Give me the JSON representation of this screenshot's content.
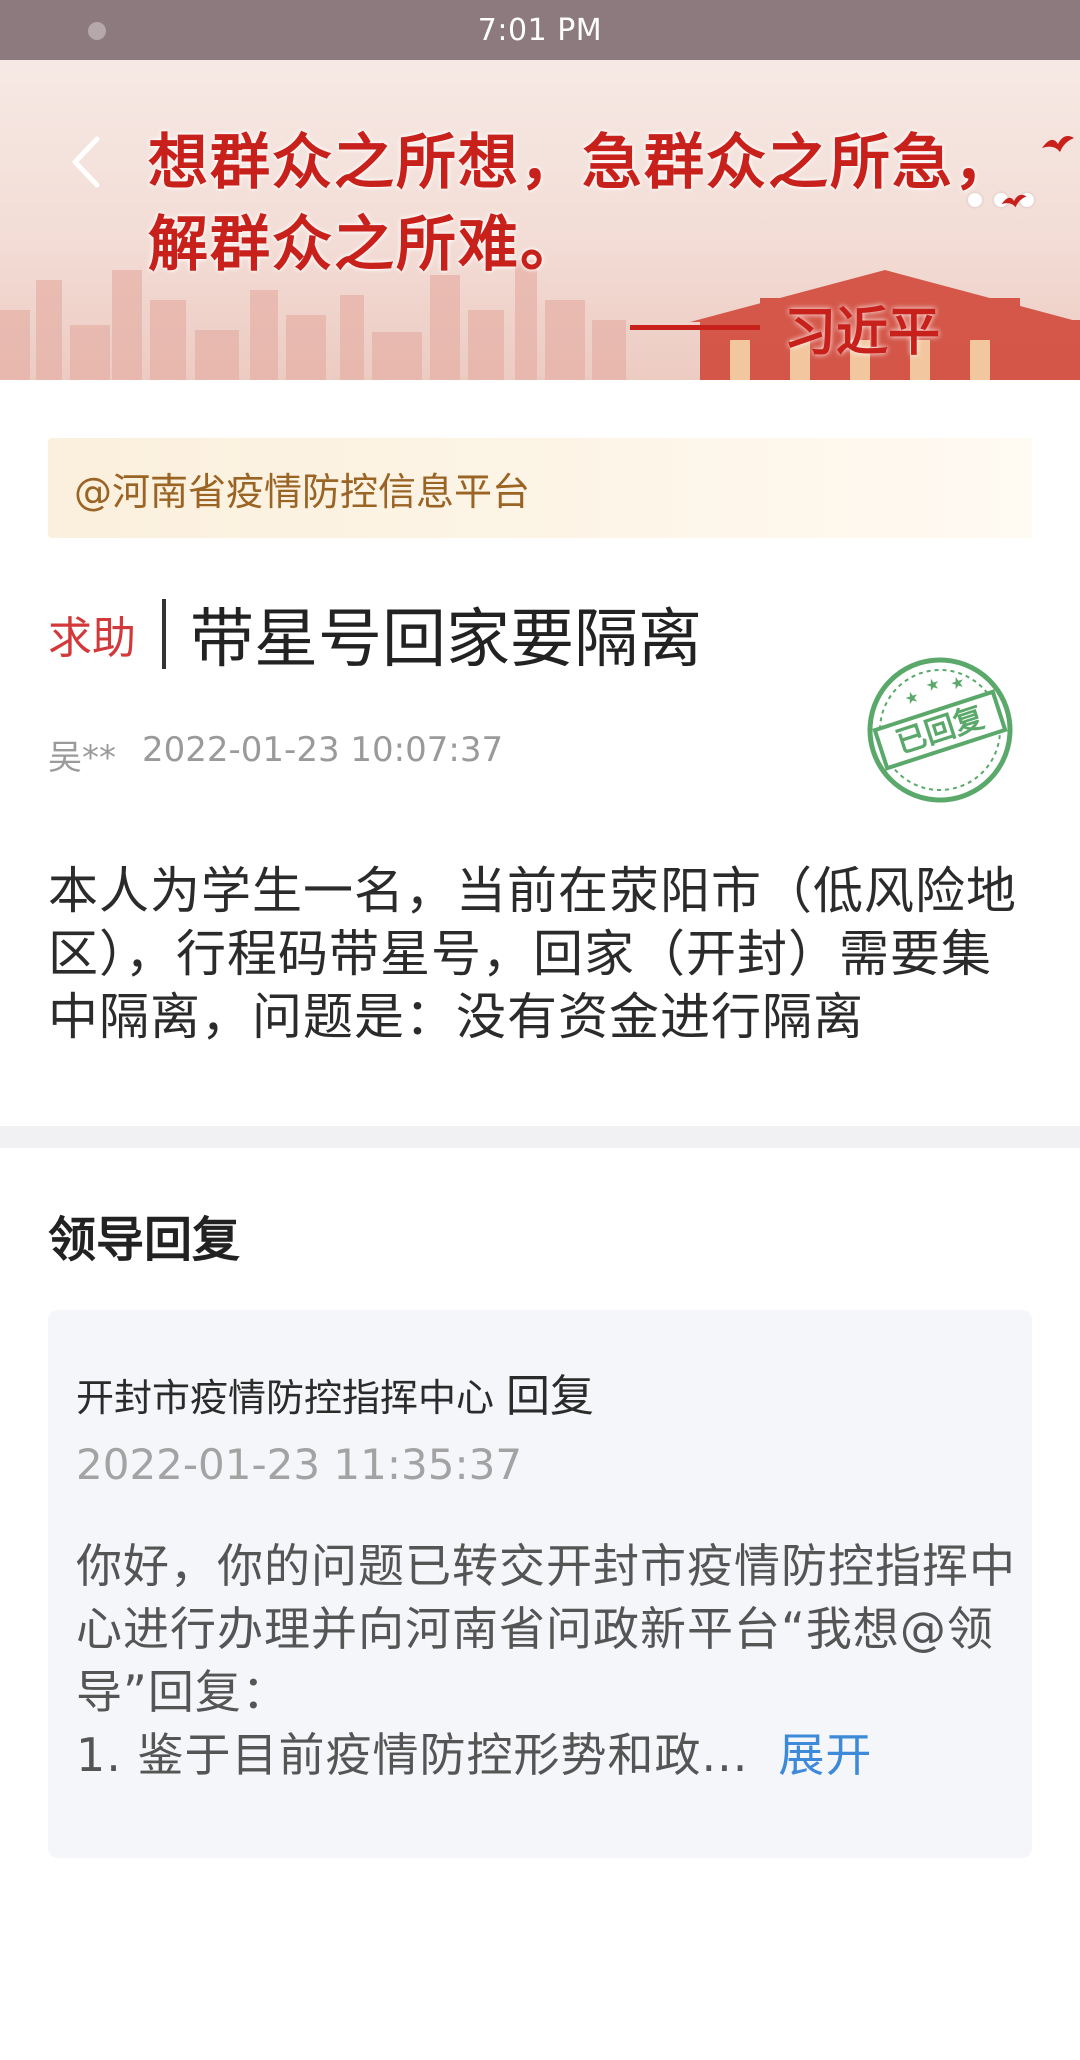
{
  "status_bar": {
    "time": "7:01 PM"
  },
  "banner": {
    "quote_lines": [
      "想群众之所想，急群众之所急，",
      "解群众之所难。"
    ],
    "author": "习近平",
    "accent_color": "#c8201b"
  },
  "platform": {
    "tag": "@河南省疫情防控信息平台"
  },
  "post": {
    "category": "求助",
    "title": "带星号回家要隔离",
    "author": "吴**",
    "datetime": "2022-01-23 10:07:37",
    "stamp_text": "已回复",
    "body": "本人为学生一名，当前在荥阳市（低风险地区），行程码带星号，回家（开封）需要集中隔离，问题是：没有资金进行隔离"
  },
  "reply_section": {
    "title": "领导回复",
    "replier": "开封市疫情防控指挥中心",
    "reply_word": "回复",
    "datetime": "2022-01-23 11:35:37",
    "text_main": "你好，你的问题已转交开封市疫情防控指挥中心进行办理并向河南省问政新平台“我想@领导”回复：",
    "text_last": "1. 鉴于目前疫情防控形势和政...",
    "expand_label": "展开"
  },
  "colors": {
    "category_red": "#d3393a",
    "tag_brown": "#9a6424",
    "link_blue": "#3d8ad9",
    "stamp_green": "#3f9a52"
  }
}
